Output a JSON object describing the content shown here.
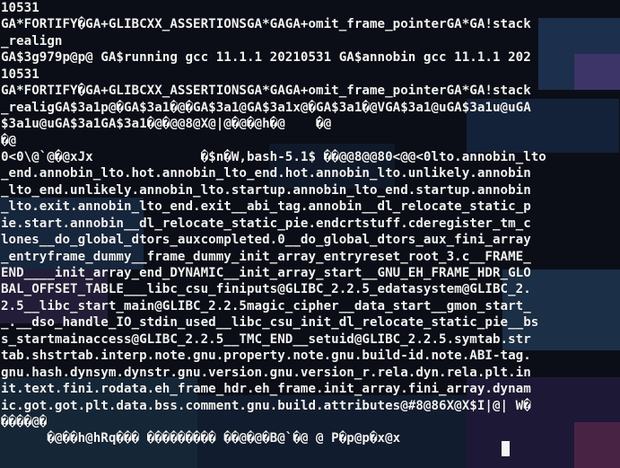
{
  "terminal": {
    "lines": [
      "10531",
      "GA*FORTIFY�GA+GLIBCXX_ASSERTIONSGA*GAGA+omit_frame_pointerGA*GA!stack",
      "_realign",
      "GA$3g979p@p@ GA$running gcc 11.1.1 20210531 GA$annobin gcc 11.1.1 202",
      "10531",
      "GA*FORTIFY�GA+GLIBCXX_ASSERTIONSGA*GAGA+omit_frame_pointerGA*GA!stack",
      "_realigGA$3a1p@�GA$3a1�@�GA$3a1@GA$3a1x@�GA$3a1�@VGA$3a1@uGA$3a1u@uGA",
      "$3a1u@uGA$3a1GA$3a1�@�@@8@X@|@�@�@h�@    �@",
      "�@",
      "0<0\\@`@�@xJx              �$n�W,bash-5.1$ ��@@8@@80<@@<0lto.annobin_lto",
      "_end.annobin_lto.hot.annobin_lto_end.hot.annobin_lto.unlikely.annobin",
      "_lto_end.unlikely.annobin_lto.startup.annobin_lto_end.startup.annobin",
      "_lto.exit.annobin_lto_end.exit__abi_tag.annobin__dl_relocate_static_p",
      "ie.start.annobin__dl_relocate_static_pie.endcrtstuff.cderegister_tm_c",
      "lones__do_global_dtors_auxcompleted.0__do_global_dtors_aux_fini_array",
      "_entryframe_dummy__frame_dummy_init_array_entryreset_root_3.c__FRAME_",
      "END____init_array_end_DYNAMIC__init_array_start__GNU_EH_FRAME_HDR_GLO",
      "BAL_OFFSET_TABLE___libc_csu_finiputs@GLIBC_2.2.5_edatasystem@GLIBC_2.",
      "2.5__libc_start_main@GLIBC_2.2.5magic_cipher__data_start__gmon_start_",
      "_.__dso_handle_IO_stdin_used__libc_csu_init_dl_relocate_static_pie__bs",
      "s_startmainaccess@GLIBC_2.2.5__TMC_END__setuid@GLIBC_2.2.5.symtab.str",
      "tab.shstrtab.interp.note.gnu.property.note.gnu.build-id.note.ABI-tag.",
      "gnu.hash.dynsym.dynstr.gnu.version.gnu.version_r.rela.dyn.rela.plt.in",
      "it.text.fini.rodata.eh_frame_hdr.eh_frame.init_array.fini_array.dynam",
      "ic.got.got.plt.data.bss.comment.gnu.build.attributes@#8@86X@X$I|@| W�",
      "����@�",
      "      �@��h@hRq��� ��������� ��@�@�B@`�@ @ P�p@p�x@x"
    ]
  }
}
